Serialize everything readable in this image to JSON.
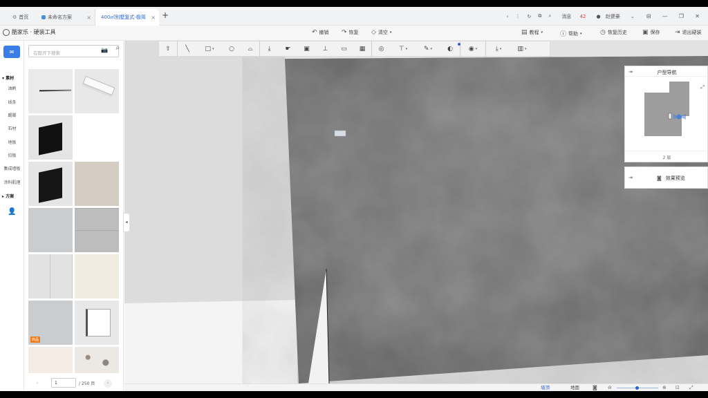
{
  "tabs": {
    "home": "首页",
    "tab1": "未命名方案",
    "tab2": "400㎡别墅复式-极简",
    "new_tab": "+"
  },
  "window": {
    "message_label": "消息",
    "message_count": "42",
    "user_name": "赵健豪"
  },
  "toolbar": {
    "logo": "酷家乐 · 硬装工具",
    "undo": "撤销",
    "redo": "恢复",
    "clear": "清空",
    "tutorial": "教程",
    "help": "帮助",
    "history": "恢复历史",
    "save": "保存",
    "exit": "退出硬装"
  },
  "sidebar": {
    "materials_head": "素材",
    "items": [
      "油刷",
      "线条",
      "踢脚",
      "石材",
      "地板",
      "扣板",
      "集成墙板",
      "涂料肌理"
    ],
    "scheme_head": "方案"
  },
  "panel": {
    "search_placeholder": "在酷开下搜索",
    "badge": "商品",
    "page_current": "1",
    "page_total": "/ 250 页"
  },
  "nav_card": {
    "title": "户型导航",
    "floor": "2 层",
    "preview": "效果预览"
  },
  "status": {
    "tab_wall": "墙顶",
    "tab_floor": "地面"
  },
  "colors": {
    "accent": "#2962d3",
    "concrete": "#6b6b6b",
    "wall_light": "#e0e0e0"
  }
}
